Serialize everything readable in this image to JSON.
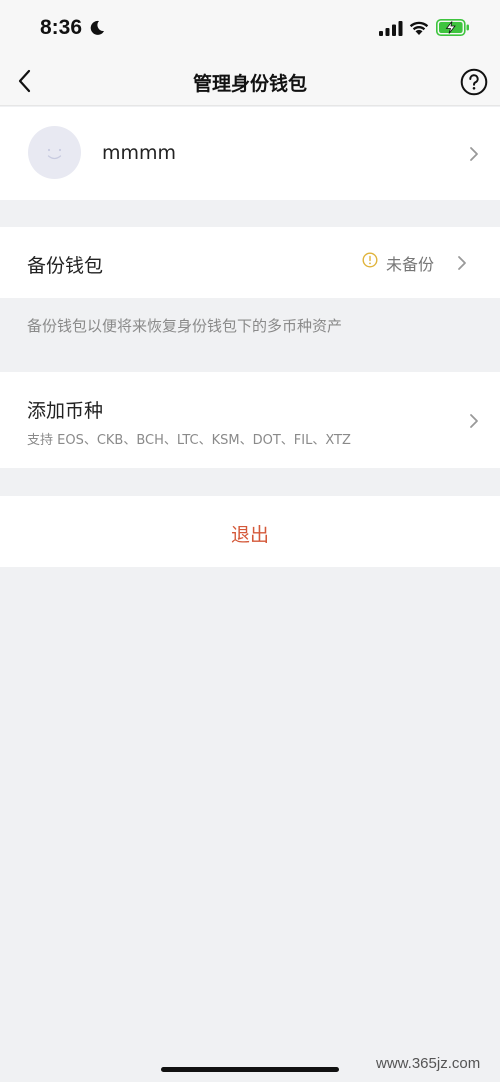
{
  "status_bar": {
    "time": "8:36",
    "icons": [
      "moon-icon",
      "signal-icon",
      "wifi-icon",
      "battery-charging-icon"
    ]
  },
  "nav": {
    "title": "管理身份钱包",
    "back_icon": "chevron-left-icon",
    "help_icon": "question-circle-icon"
  },
  "profile": {
    "name": "mmmm",
    "avatar_icon": "smiley-face-icon"
  },
  "backup": {
    "label": "备份钱包",
    "status": "未备份",
    "status_icon": "warning-circle-icon",
    "hint": "备份钱包以便将来恢复身份钱包下的多币种资产"
  },
  "add_coin": {
    "title": "添加币种",
    "subtitle": "支持 EOS、CKB、BCH、LTC、KSM、DOT、FIL、XTZ"
  },
  "logout": {
    "label": "退出"
  },
  "watermark": "www.365jz.com",
  "colors": {
    "background": "#f0f1f3",
    "card": "#ffffff",
    "logout": "#d4593a",
    "warning": "#e0b43c",
    "battery": "#3ec43e"
  }
}
